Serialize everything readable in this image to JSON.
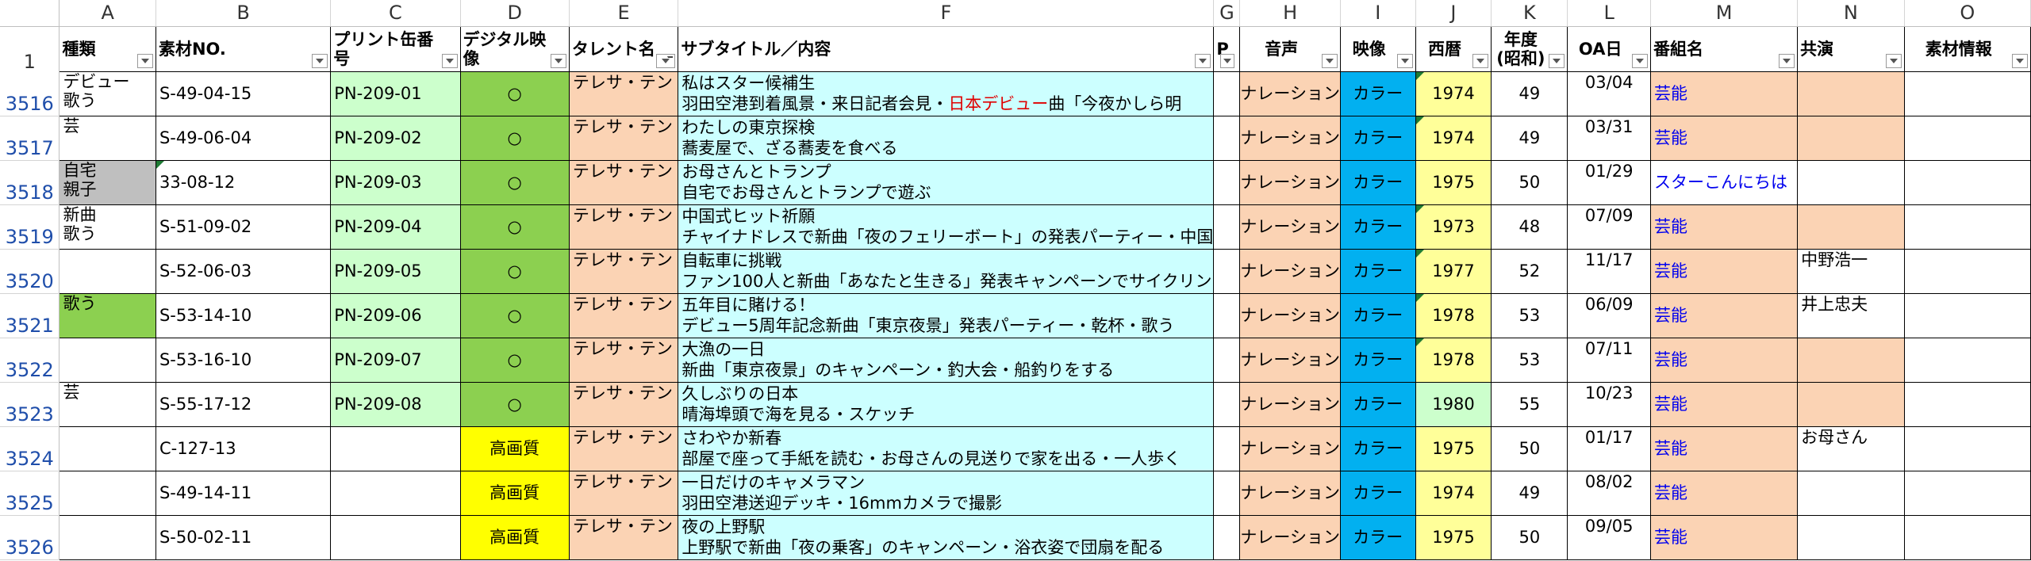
{
  "sheet": {
    "column_letters": [
      "A",
      "B",
      "C",
      "D",
      "E",
      "F",
      "G",
      "H",
      "I",
      "J",
      "K",
      "L",
      "M",
      "N",
      "O"
    ],
    "header_row_number": "1",
    "fields": {
      "A": "種類",
      "B": "素材NO.",
      "C": "プリント缶番号",
      "D": "デジタル映像",
      "E": "タレント名",
      "F": "サブタイトル／内容",
      "G": "P",
      "H": "音声",
      "I": "映像",
      "J": "西暦",
      "K": "年度(昭和)",
      "L": "OA日",
      "M": "番組名",
      "N": "共演",
      "O": "素材情報"
    },
    "rows": [
      {
        "num": "3516",
        "type": "デビュー\n歌う",
        "no": "S-49-04-15",
        "print": "PN-209-01",
        "digital": "○",
        "talent": "テレサ・テン",
        "sub1": "私はスター候補生",
        "sub2_a": "羽田空港到着風景・来日記者会見・",
        "sub2_red": "日本デビュー",
        "sub2_b": "曲「今夜かしら明",
        "audio": "ナレーション",
        "video": "カラー",
        "year": "1974",
        "showa": "49",
        "oa": "03/04",
        "program": "芸能",
        "costar": ""
      },
      {
        "num": "3517",
        "type": "芸",
        "no": "S-49-06-04",
        "print": "PN-209-02",
        "digital": "○",
        "talent": "テレサ・テン",
        "sub1": "わたしの東京探検",
        "sub2_a": "蕎麦屋で、ざる蕎麦を食べる",
        "sub2_red": "",
        "sub2_b": "",
        "audio": "ナレーション",
        "video": "カラー",
        "year": "1974",
        "showa": "49",
        "oa": "03/31",
        "program": "芸能",
        "costar": ""
      },
      {
        "num": "3518",
        "type": "自宅\n親子",
        "no": "33-08-12",
        "print": "PN-209-03",
        "digital": "○",
        "talent": "テレサ・テン",
        "sub1": "お母さんとトランプ",
        "sub2_a": "自宅でお母さんとトランプで遊ぶ",
        "sub2_red": "",
        "sub2_b": "",
        "audio": "ナレーション",
        "video": "カラー",
        "year": "1975",
        "showa": "50",
        "oa": "01/29",
        "program": "スターこんにちは",
        "costar": ""
      },
      {
        "num": "3519",
        "type": "新曲\n歌う",
        "no": "S-51-09-02",
        "print": "PN-209-04",
        "digital": "○",
        "talent": "テレサ・テン",
        "sub1": "中国式ヒット祈願",
        "sub2_a": "チャイナドレスで新曲「夜のフェリーボート」の発表パーティー・中国",
        "sub2_red": "",
        "sub2_b": "",
        "audio": "ナレーション",
        "video": "カラー",
        "year": "1973",
        "showa": "48",
        "oa": "07/09",
        "program": "芸能",
        "costar": ""
      },
      {
        "num": "3520",
        "type": "",
        "no": "S-52-06-03",
        "print": "PN-209-05",
        "digital": "○",
        "talent": "テレサ・テン",
        "sub1": "自転車に挑戦",
        "sub2_a": "ファン100人と新曲「あなたと生きる」発表キャンペーンでサイクリン",
        "sub2_red": "",
        "sub2_b": "",
        "audio": "ナレーション",
        "video": "カラー",
        "year": "1977",
        "showa": "52",
        "oa": "11/17",
        "program": "芸能",
        "costar": "中野浩一"
      },
      {
        "num": "3521",
        "type": "歌う",
        "no": "S-53-14-10",
        "print": "PN-209-06",
        "digital": "○",
        "talent": "テレサ・テン",
        "sub1": "五年目に賭ける！",
        "sub2_a": "デビュー5周年記念新曲「東京夜景」発表パーティー・乾杯・歌う",
        "sub2_red": "",
        "sub2_b": "",
        "audio": "ナレーション",
        "video": "カラー",
        "year": "1978",
        "showa": "53",
        "oa": "06/09",
        "program": "芸能",
        "costar": "井上忠夫"
      },
      {
        "num": "3522",
        "type": "",
        "no": "S-53-16-10",
        "print": "PN-209-07",
        "digital": "○",
        "talent": "テレサ・テン",
        "sub1": "大漁の一日",
        "sub2_a": "新曲「東京夜景」のキャンペーン・釣大会・船釣りをする",
        "sub2_red": "",
        "sub2_b": "",
        "audio": "ナレーション",
        "video": "カラー",
        "year": "1978",
        "showa": "53",
        "oa": "07/11",
        "program": "芸能",
        "costar": ""
      },
      {
        "num": "3523",
        "type": "芸",
        "no": "S-55-17-12",
        "print": "PN-209-08",
        "digital": "○",
        "talent": "テレサ・テン",
        "sub1": "久しぶりの日本",
        "sub2_a": "晴海埠頭で海を見る・スケッチ",
        "sub2_red": "",
        "sub2_b": "",
        "audio": "ナレーション",
        "video": "カラー",
        "year": "1980",
        "showa": "55",
        "oa": "10/23",
        "program": "芸能",
        "costar": ""
      },
      {
        "num": "3524",
        "type": "",
        "no": "C-127-13",
        "print": "",
        "digital": "高画質",
        "talent": "テレサ・テン",
        "sub1": "さわやか新春",
        "sub2_a": "部屋で座って手紙を読む・お母さんの見送りで家を出る・一人歩く",
        "sub2_red": "",
        "sub2_b": "",
        "audio": "ナレーション",
        "video": "カラー",
        "year": "1975",
        "showa": "50",
        "oa": "01/17",
        "program": "芸能",
        "costar": "お母さん"
      },
      {
        "num": "3525",
        "type": "",
        "no": "S-49-14-11",
        "print": "",
        "digital": "高画質",
        "talent": "テレサ・テン",
        "sub1": "一日だけのキャメラマン",
        "sub2_a": "羽田空港送迎デッキ・16mmカメラで撮影",
        "sub2_red": "",
        "sub2_b": "",
        "audio": "ナレーション",
        "video": "カラー",
        "year": "1974",
        "showa": "49",
        "oa": "08/02",
        "program": "芸能",
        "costar": ""
      },
      {
        "num": "3526",
        "type": "",
        "no": "S-50-02-11",
        "print": "",
        "digital": "高画質",
        "talent": "テレサ・テン",
        "sub1": "夜の上野駅",
        "sub2_a": "上野駅で新曲「夜の乗客」のキャンペーン・浴衣姿で団扇を配る",
        "sub2_red": "",
        "sub2_b": "",
        "audio": "ナレーション",
        "video": "カラー",
        "year": "1975",
        "showa": "50",
        "oa": "09/05",
        "program": "芸能",
        "costar": ""
      }
    ]
  },
  "colors": {
    "field_B": "#ffc000",
    "print_cell": "#ccffcc",
    "digital_ok": "#8cd050",
    "digital_hq": "#ffff00",
    "talent": "#fbd3b4",
    "subtitle": "#ccffff",
    "audio": "#fbd3b4",
    "video": "#02b0f0",
    "year": "#ffff99",
    "program": "#fbd3b4",
    "row_number": "#1f4eaa"
  }
}
